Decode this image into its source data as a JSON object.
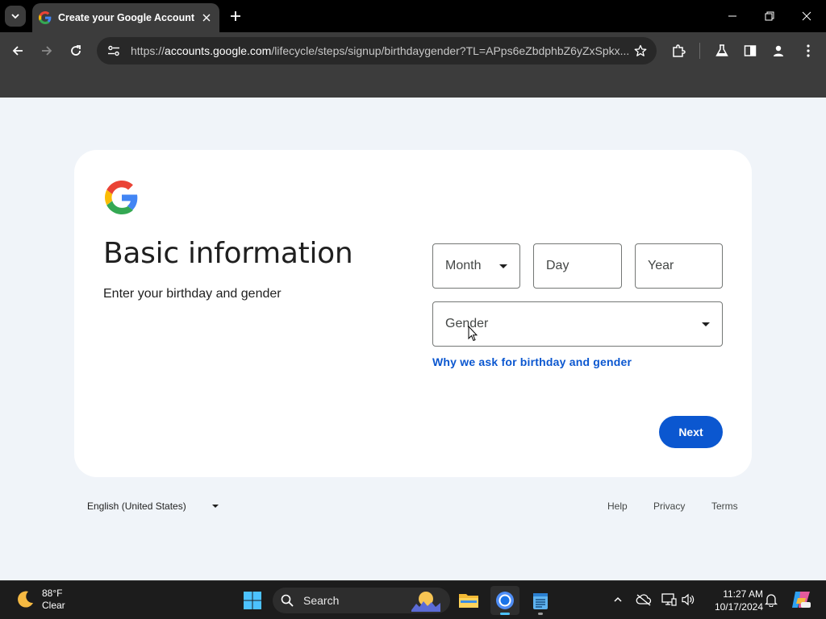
{
  "browser": {
    "tab_title": "Create your Google Account",
    "url_scheme": "https://",
    "url_host": "accounts.google.com",
    "url_path": "/lifecycle/steps/signup/birthdaygender?TL=APps6eZbdphbZ6yZxSpkx..."
  },
  "page": {
    "heading": "Basic information",
    "subheading": "Enter your birthday and gender",
    "month_placeholder": "Month",
    "day_placeholder": "Day",
    "year_placeholder": "Year",
    "gender_placeholder": "Gender",
    "why_link": "Why we ask for birthday and gender",
    "next_label": "Next"
  },
  "footer": {
    "language": "English (United States)",
    "help": "Help",
    "privacy": "Privacy",
    "terms": "Terms"
  },
  "taskbar": {
    "weather_temp": "88°F",
    "weather_cond": "Clear",
    "search_label": "Search",
    "time": "11:27 AM",
    "date": "10/17/2024"
  },
  "colors": {
    "accent": "#0b57d0",
    "page_bg": "#f0f4f9",
    "chrome_bg": "#3c3c3c"
  }
}
